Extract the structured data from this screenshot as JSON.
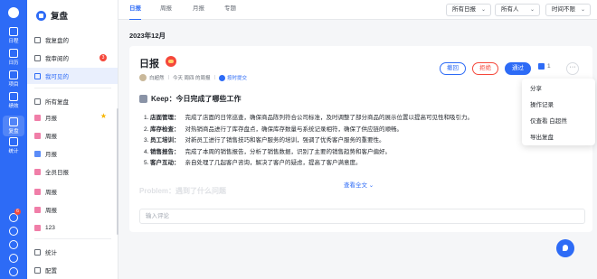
{
  "rail": {
    "items": [
      {
        "label": "日程",
        "icon": "calendar-icon"
      },
      {
        "label": "日历",
        "icon": "calendar-grid-icon"
      },
      {
        "label": "项目",
        "icon": "project-icon"
      },
      {
        "label": "绩效",
        "icon": "performance-icon"
      },
      {
        "label": "复盘",
        "icon": "review-icon"
      },
      {
        "label": "统计",
        "icon": "stats-icon"
      }
    ],
    "badge": "6",
    "accent": "#2d6bf6"
  },
  "nav": {
    "title": "复盘",
    "items": [
      {
        "label": "我复盘的"
      },
      {
        "label": "我审阅的",
        "badge": "3"
      },
      {
        "label": "我可见的"
      },
      {
        "label": "所有复盘"
      },
      {
        "label": "月报"
      },
      {
        "label": "周报"
      },
      {
        "label": "月报"
      },
      {
        "label": "全员日报"
      },
      {
        "label": "周报"
      },
      {
        "label": "周报"
      },
      {
        "label": "123"
      },
      {
        "label": "统计"
      },
      {
        "label": "配置"
      }
    ]
  },
  "tabs": [
    "日报",
    "周报",
    "月报",
    "专题"
  ],
  "filters": [
    "所有日报",
    "所有人",
    "时间不限"
  ],
  "month": "2023年12月",
  "report": {
    "title": "日报",
    "author": "白超然",
    "date": "今天 周四 的周报",
    "ontime": "按时提交",
    "actions": {
      "return": "撤回",
      "reject": "拒绝",
      "pass": "通过"
    },
    "likes": "1",
    "more": "···"
  },
  "keep": {
    "heading": "Keep：今日完成了哪些工作",
    "items": [
      {
        "num": "1.",
        "title": "店面管理：",
        "text": "完成了店面的日常巡查，确保商品陈列符合公司标准，及时调整了部分商品的展示位置以提高可见性和吸引力。"
      },
      {
        "num": "2.",
        "title": "库存检查：",
        "text": "对热销商品进行了库存盘点，确保库存数量与系统记录相符，确保了供应链的顺畅。"
      },
      {
        "num": "3.",
        "title": "员工培训：",
        "text": "对新员工进行了销售技巧和客户服务的培训，强调了优秀客户服务的重要性。"
      },
      {
        "num": "4.",
        "title": "销售报告：",
        "text": "完成了本周的销售报告，分析了销售数据，识别了主要的销售趋势和客户偏好。"
      },
      {
        "num": "5.",
        "title": "客户互动：",
        "text": "亲自处理了几起客户咨询，解决了客户的疑虑，提高了客户满意度。"
      }
    ]
  },
  "problem_heading": "Problem：遇到了什么问题",
  "view_all": "查看全文 ⌄",
  "comment_placeholder": "输入评论",
  "popup": [
    "分享",
    "操作记录",
    "仅查看 白超然",
    "导出复盘"
  ]
}
